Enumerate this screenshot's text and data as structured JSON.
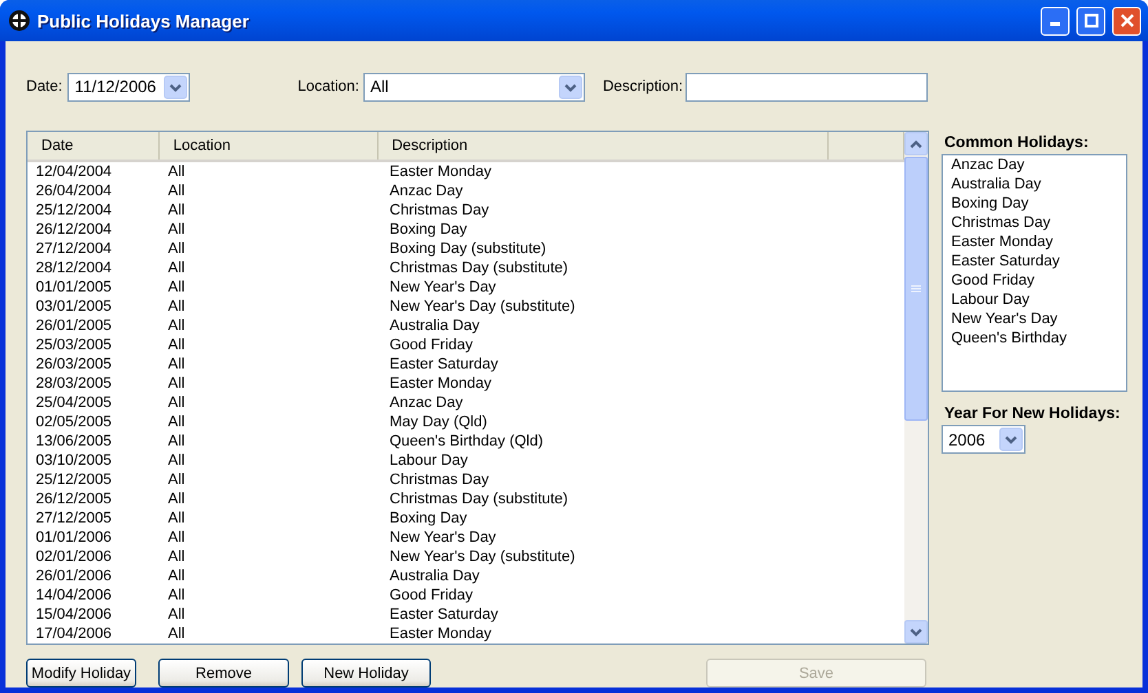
{
  "window": {
    "title": "Public Holidays Manager"
  },
  "filters": {
    "date_label": "Date:",
    "date_value": "11/12/2006",
    "location_label": "Location:",
    "location_value": "All",
    "description_label": "Description:"
  },
  "table": {
    "columns": [
      "Date",
      "Location",
      "Description"
    ],
    "rows": [
      [
        "12/04/2004",
        "All",
        "Easter Monday"
      ],
      [
        "26/04/2004",
        "All",
        "Anzac Day"
      ],
      [
        "25/12/2004",
        "All",
        "Christmas Day"
      ],
      [
        "26/12/2004",
        "All",
        "Boxing Day"
      ],
      [
        "27/12/2004",
        "All",
        "Boxing Day (substitute)"
      ],
      [
        "28/12/2004",
        "All",
        "Christmas Day (substitute)"
      ],
      [
        "01/01/2005",
        "All",
        "New Year's Day"
      ],
      [
        "03/01/2005",
        "All",
        "New Year's Day (substitute)"
      ],
      [
        "26/01/2005",
        "All",
        "Australia Day"
      ],
      [
        "25/03/2005",
        "All",
        "Good Friday"
      ],
      [
        "26/03/2005",
        "All",
        "Easter Saturday"
      ],
      [
        "28/03/2005",
        "All",
        "Easter Monday"
      ],
      [
        "25/04/2005",
        "All",
        "Anzac Day"
      ],
      [
        "02/05/2005",
        "All",
        "May Day (Qld)"
      ],
      [
        "13/06/2005",
        "All",
        "Queen's Birthday (Qld)"
      ],
      [
        "03/10/2005",
        "All",
        "Labour Day"
      ],
      [
        "25/12/2005",
        "All",
        "Christmas Day"
      ],
      [
        "26/12/2005",
        "All",
        "Christmas Day (substitute)"
      ],
      [
        "27/12/2005",
        "All",
        "Boxing Day"
      ],
      [
        "01/01/2006",
        "All",
        "New Year's Day"
      ],
      [
        "02/01/2006",
        "All",
        "New Year's Day (substitute)"
      ],
      [
        "26/01/2006",
        "All",
        "Australia Day"
      ],
      [
        "14/04/2006",
        "All",
        "Good Friday"
      ],
      [
        "15/04/2006",
        "All",
        "Easter Saturday"
      ],
      [
        "17/04/2006",
        "All",
        "Easter Monday"
      ]
    ]
  },
  "common_holidays": {
    "label": "Common Holidays:",
    "items": [
      "Anzac Day",
      "Australia Day",
      "Boxing Day",
      "Christmas Day",
      "Easter Monday",
      "Easter Saturday",
      "Good Friday",
      "Labour Day",
      "New Year's Day",
      "Queen's Birthday"
    ]
  },
  "year": {
    "label": "Year For New Holidays:",
    "value": "2006"
  },
  "buttons": [
    {
      "label": "Modify Holiday",
      "disabled": false
    },
    {
      "label": "Remove",
      "disabled": false
    },
    {
      "label": "New Holiday",
      "disabled": false
    },
    {
      "label": "Save",
      "disabled": true
    }
  ]
}
